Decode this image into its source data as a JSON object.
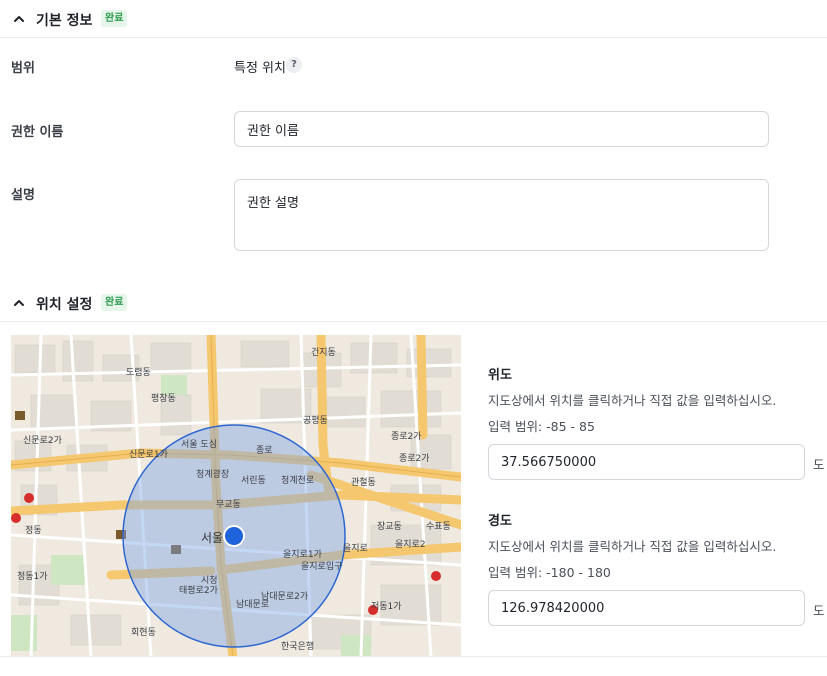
{
  "basic_section": {
    "title": "기본 정보",
    "badge": "완료"
  },
  "scope": {
    "label": "범위",
    "value": "특정 위치",
    "help_icon": "?"
  },
  "permission_name": {
    "label": "권한 이름",
    "value": "권한 이름"
  },
  "description": {
    "label": "설명",
    "value": "권한 설명"
  },
  "location_section": {
    "title": "위치 설정",
    "badge": "완료"
  },
  "latitude": {
    "title": "위도",
    "description": "지도상에서 위치를 클릭하거나 직접 값을 입력하십시오.",
    "range": "입력 범위: -85 - 85",
    "value": "37.566750000",
    "unit": "도"
  },
  "longitude": {
    "title": "경도",
    "description": "지도상에서 위치를 클릭하거나 직접 값을 입력하십시오.",
    "range": "입력 범위: -180 - 180",
    "value": "126.978420000",
    "unit": "도"
  },
  "map": {
    "labels": {
      "center": "서울시청",
      "l1": "건지동",
      "l2": "도렴동",
      "l3": "신문로2가",
      "l4": "신문로1가",
      "l5": "서울 도심",
      "l6": "종로",
      "l7": "청계광장",
      "l8": "을지로1가",
      "l9": "을지로입구",
      "l10": "을지로",
      "l11": "남대문로2가",
      "l12": "청계천로",
      "l13": "정동",
      "l14": "시청",
      "l15": "장교동",
      "l16": "수표동",
      "l17": "종로2가",
      "l18": "공평동",
      "l19": "서린동",
      "l20": "태평로2가",
      "l21": "회현동",
      "l22": "저동1가",
      "l23": "관철동",
      "l24": "평창동",
      "l25": "한국은행",
      "l26": "남대문로",
      "l27": "무교동",
      "l28": "정동1가",
      "l29": "종로2가",
      "l30": "을지로2"
    },
    "colors": {
      "circle_fill": "#7ea6e6",
      "circle_stroke": "#2e66d1",
      "marker": "#1f63dd",
      "road_major": "#f5c76f",
      "road_minor": "#ffffff",
      "park": "#cfe6c3"
    }
  }
}
